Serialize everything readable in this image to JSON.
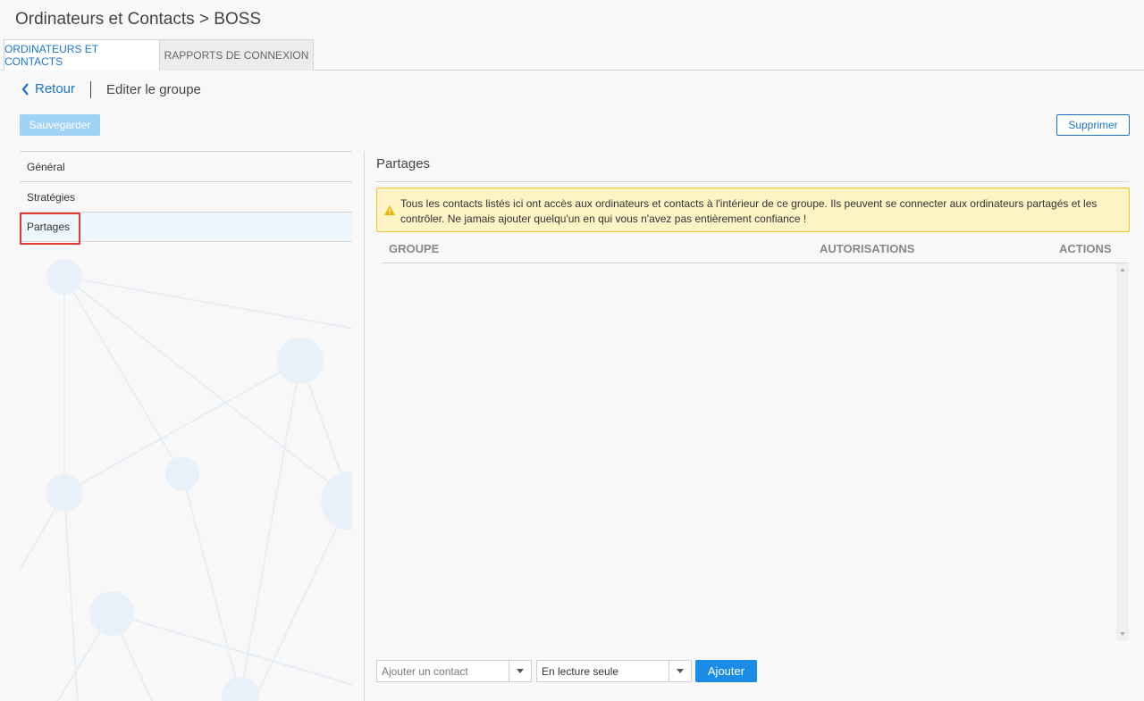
{
  "header": {
    "title": "Ordinateurs et Contacts > BOSS"
  },
  "tabs": [
    {
      "label": "ORDINATEURS ET CONTACTS",
      "active": true
    },
    {
      "label": "RAPPORTS DE CONNEXION",
      "active": false
    }
  ],
  "toolbar": {
    "back_label": "Retour",
    "back_icon": "chevron-left-icon",
    "page_subtitle": "Editer le groupe",
    "save_label": "Sauvegarder",
    "delete_label": "Supprimer"
  },
  "sidebar": {
    "items": [
      {
        "label": "Général"
      },
      {
        "label": "Stratégies"
      },
      {
        "label": "Partages",
        "selected": true
      }
    ]
  },
  "main": {
    "section_title": "Partages",
    "warning": {
      "icon": "warning-icon",
      "text": "Tous les contacts listés ici ont accès aux ordinateurs et contacts à l'intérieur de ce groupe. Ils peuvent se connecter aux ordinateurs partagés et les contrôler. Ne jamais ajouter quelqu'un en qui vous n'avez pas entièrement confiance !"
    },
    "table": {
      "columns": [
        "GROUPE",
        "AUTORISATIONS",
        "ACTIONS"
      ],
      "rows": []
    },
    "footer": {
      "contact_placeholder": "Ajouter un contact",
      "permission_value": "En lecture seule",
      "add_label": "Ajouter"
    }
  },
  "colors": {
    "accent": "#1a73c9",
    "primary_button": "#1a8ce8",
    "warning_bg": "#fdf3c4",
    "warning_border": "#f2c230",
    "highlight": "#e53935"
  }
}
